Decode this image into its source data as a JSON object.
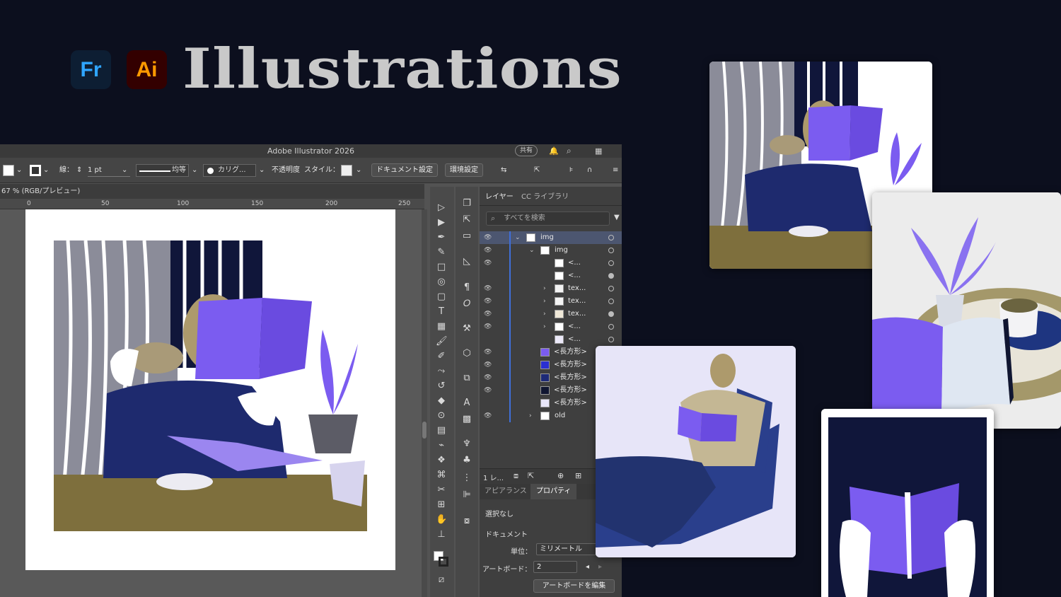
{
  "header": {
    "title": "Illustrations",
    "logos": [
      {
        "label": "Fr",
        "bg": "#0d1e33",
        "fg": "#2fa5ff"
      },
      {
        "label": "Ai",
        "bg": "#330000",
        "fg": "#ff9a00"
      }
    ]
  },
  "app": {
    "window_title": "Adobe Illustrator 2026",
    "share_label": "共有",
    "control_bar": {
      "stroke_label": "線：",
      "stroke_value": "1 pt",
      "stroke_profile": "均等",
      "brush": "カリグ...",
      "opacity_label": "不透明度",
      "style_label": "スタイル：",
      "doc_settings": "ドキュメント設定",
      "preferences": "環境設定"
    },
    "doc_tab": "67 % (RGB/プレビュー)",
    "ruler_ticks": [
      "0",
      "50",
      "100",
      "150",
      "200",
      "250"
    ],
    "panel": {
      "tabs": [
        "レイヤー",
        "CC ライブラリ"
      ],
      "search_placeholder": "すべてを検索",
      "layers": [
        {
          "label": "img",
          "thumb": "#ffffff"
        },
        {
          "label": "img",
          "thumb": "#ffffff"
        },
        {
          "label": "<...",
          "thumb": "#ffffff"
        },
        {
          "label": "<...",
          "thumb": "#ffffff"
        },
        {
          "label": "tex...",
          "thumb": "#f3f3f3"
        },
        {
          "label": "tex...",
          "thumb": "#f3f3f3"
        },
        {
          "label": "tex...",
          "thumb": "#efe8d8"
        },
        {
          "label": "<...",
          "thumb": "#ffffff"
        },
        {
          "label": "<...",
          "thumb": "#ece9f9"
        },
        {
          "label": "<長方形>",
          "thumb": "#7b5cf0"
        },
        {
          "label": "<長方形>",
          "thumb": "#2a2fd2"
        },
        {
          "label": "<長方形>",
          "thumb": "#1d2a77"
        },
        {
          "label": "<長方形>",
          "thumb": "#101631"
        },
        {
          "label": "<長方形>",
          "thumb": "#e7e5f8"
        },
        {
          "label": "old",
          "thumb": "#ffffff"
        }
      ],
      "footer_count": "1 レ...",
      "lower_tabs": [
        "アピアランス",
        "プロパティ"
      ],
      "no_selection": "選択なし",
      "document_label": "ドキュメント",
      "unit_label": "単位：",
      "unit_value": "ミリメートル",
      "artboard_label": "アートボード：",
      "artboard_value": "2",
      "edit_artboard": "アートボードを編集"
    }
  },
  "colors": {
    "background": "#0c0f1e",
    "violet": "#7b5cf0",
    "navy": "#1e2a6e",
    "olive": "#7e6f3d",
    "stripe_gray": "#8b8c99"
  }
}
